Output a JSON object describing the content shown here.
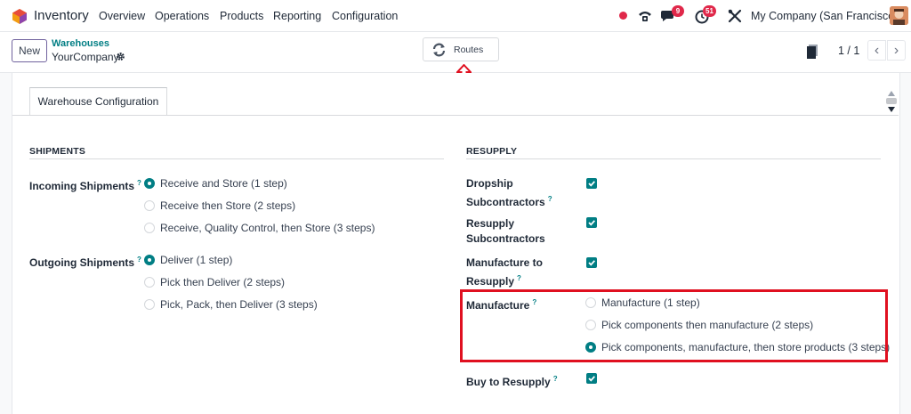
{
  "topbar": {
    "app_name": "Inventory",
    "menu": [
      "Overview",
      "Operations",
      "Products",
      "Reporting",
      "Configuration"
    ],
    "chat_badge": "9",
    "activity_badge": "51",
    "company": "My Company (San Francisco)"
  },
  "control_panel": {
    "new_label": "New",
    "breadcrumb_parent": "Warehouses",
    "breadcrumb_current": "YourCompany",
    "routes_label": "Routes",
    "pager_value": "1 / 1"
  },
  "tabs": [
    "Warehouse Configuration"
  ],
  "shipments": {
    "title": "SHIPMENTS",
    "incoming": {
      "label": "Incoming Shipments",
      "help": "?",
      "options": [
        "Receive and Store (1 step)",
        "Receive then Store (2 steps)",
        "Receive, Quality Control, then Store (3 steps)"
      ],
      "selected": 0
    },
    "outgoing": {
      "label": "Outgoing Shipments",
      "help": "?",
      "options": [
        "Deliver (1 step)",
        "Pick then Deliver (2 steps)",
        "Pick, Pack, then Deliver (3 steps)"
      ],
      "selected": 0
    }
  },
  "resupply": {
    "title": "RESUPPLY",
    "dropship": {
      "label_line1": "Dropship",
      "label_line2": "Subcontractors",
      "help": "?",
      "checked": true
    },
    "resupply_sub": {
      "label_line1": "Resupply",
      "label_line2": "Subcontractors",
      "checked": true
    },
    "manufacture_to_resupply": {
      "label_line1": "Manufacture to",
      "label_line2": "Resupply",
      "help": "?",
      "checked": true
    },
    "manufacture": {
      "label": "Manufacture",
      "help": "?",
      "options": [
        "Manufacture (1 step)",
        "Pick components then manufacture (2 steps)",
        "Pick components, manufacture, then store products (3 steps)"
      ],
      "selected": 2
    },
    "buy": {
      "label": "Buy to Resupply",
      "help": "?",
      "checked": true
    }
  },
  "colors": {
    "accent": "#017e84",
    "brand": "#71639e",
    "badge": "#e0284a",
    "highlight": "#e01020"
  }
}
